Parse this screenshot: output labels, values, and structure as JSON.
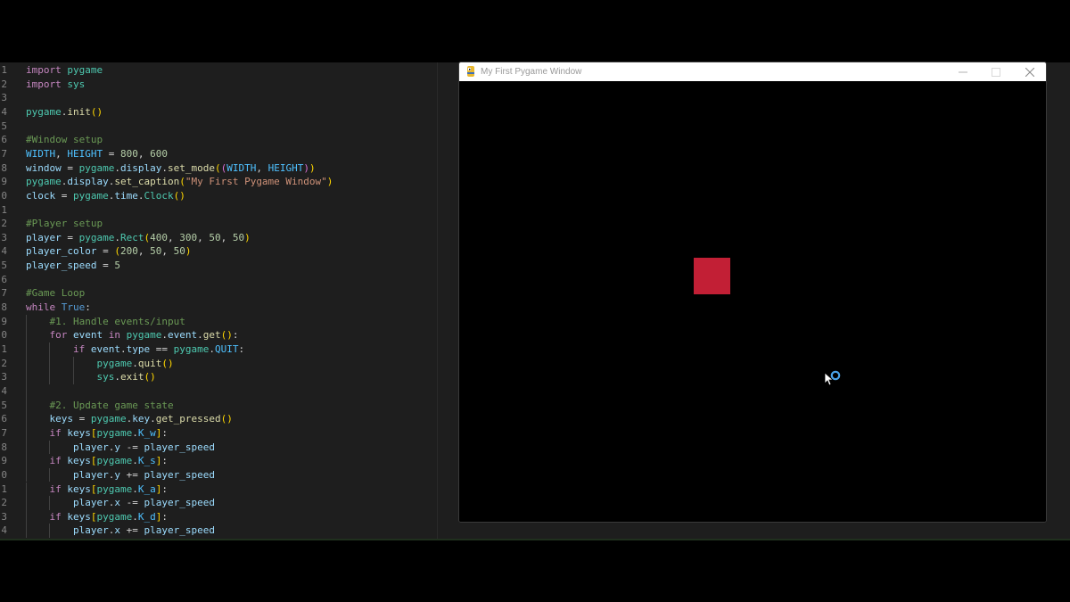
{
  "editor": {
    "line_numbers": [
      "1",
      "2",
      "3",
      "4",
      "5",
      "6",
      "7",
      "8",
      "9",
      "0",
      "1",
      "2",
      "3",
      "4",
      "5",
      "6",
      "7",
      "8",
      "9",
      "0",
      "1",
      "2",
      "3",
      "4",
      "5",
      "6",
      "7",
      "8",
      "9",
      "0",
      "1",
      "2",
      "3",
      "4"
    ],
    "lines": [
      [
        [
          "kw",
          "import"
        ],
        [
          "op",
          " "
        ],
        [
          "cls",
          "pygame"
        ]
      ],
      [
        [
          "kw",
          "import"
        ],
        [
          "op",
          " "
        ],
        [
          "cls",
          "sys"
        ]
      ],
      [],
      [
        [
          "cls",
          "pygame"
        ],
        [
          "op",
          "."
        ],
        [
          "fn",
          "init"
        ],
        [
          "br1",
          "()"
        ]
      ],
      [],
      [
        [
          "com",
          "#Window setup"
        ]
      ],
      [
        [
          "const",
          "WIDTH"
        ],
        [
          "op",
          ", "
        ],
        [
          "const",
          "HEIGHT"
        ],
        [
          "op",
          " = "
        ],
        [
          "num",
          "800"
        ],
        [
          "op",
          ", "
        ],
        [
          "num",
          "600"
        ]
      ],
      [
        [
          "var",
          "window"
        ],
        [
          "op",
          " = "
        ],
        [
          "cls",
          "pygame"
        ],
        [
          "op",
          "."
        ],
        [
          "var",
          "display"
        ],
        [
          "op",
          "."
        ],
        [
          "fn",
          "set_mode"
        ],
        [
          "br1",
          "("
        ],
        [
          "br2",
          "("
        ],
        [
          "const",
          "WIDTH"
        ],
        [
          "op",
          ", "
        ],
        [
          "const",
          "HEIGHT"
        ],
        [
          "br2",
          ")"
        ],
        [
          "br1",
          ")"
        ]
      ],
      [
        [
          "cls",
          "pygame"
        ],
        [
          "op",
          "."
        ],
        [
          "var",
          "display"
        ],
        [
          "op",
          "."
        ],
        [
          "fn",
          "set_caption"
        ],
        [
          "br1",
          "("
        ],
        [
          "str",
          "\"My First Pygame Window\""
        ],
        [
          "br1",
          ")"
        ]
      ],
      [
        [
          "var",
          "clock"
        ],
        [
          "op",
          " = "
        ],
        [
          "cls",
          "pygame"
        ],
        [
          "op",
          "."
        ],
        [
          "var",
          "time"
        ],
        [
          "op",
          "."
        ],
        [
          "cls",
          "Clock"
        ],
        [
          "br1",
          "()"
        ]
      ],
      [],
      [
        [
          "com",
          "#Player setup"
        ]
      ],
      [
        [
          "var",
          "player"
        ],
        [
          "op",
          " = "
        ],
        [
          "cls",
          "pygame"
        ],
        [
          "op",
          "."
        ],
        [
          "cls",
          "Rect"
        ],
        [
          "br1",
          "("
        ],
        [
          "num",
          "400"
        ],
        [
          "op",
          ", "
        ],
        [
          "num",
          "300"
        ],
        [
          "op",
          ", "
        ],
        [
          "num",
          "50"
        ],
        [
          "op",
          ", "
        ],
        [
          "num",
          "50"
        ],
        [
          "br1",
          ")"
        ]
      ],
      [
        [
          "var",
          "player_color"
        ],
        [
          "op",
          " = "
        ],
        [
          "br1",
          "("
        ],
        [
          "num",
          "200"
        ],
        [
          "op",
          ", "
        ],
        [
          "num",
          "50"
        ],
        [
          "op",
          ", "
        ],
        [
          "num",
          "50"
        ],
        [
          "br1",
          ")"
        ]
      ],
      [
        [
          "var",
          "player_speed"
        ],
        [
          "op",
          " = "
        ],
        [
          "num",
          "5"
        ]
      ],
      [],
      [
        [
          "com",
          "#Game Loop"
        ]
      ],
      [
        [
          "kw",
          "while"
        ],
        [
          "op",
          " "
        ],
        [
          "kw2",
          "True"
        ],
        [
          "op",
          ":"
        ]
      ],
      [
        [
          "op",
          "    "
        ],
        [
          "com",
          "#1. Handle events/input"
        ]
      ],
      [
        [
          "op",
          "    "
        ],
        [
          "kw",
          "for"
        ],
        [
          "op",
          " "
        ],
        [
          "var",
          "event"
        ],
        [
          "op",
          " "
        ],
        [
          "kw",
          "in"
        ],
        [
          "op",
          " "
        ],
        [
          "cls",
          "pygame"
        ],
        [
          "op",
          "."
        ],
        [
          "var",
          "event"
        ],
        [
          "op",
          "."
        ],
        [
          "fn",
          "get"
        ],
        [
          "br1",
          "()"
        ],
        [
          "op",
          ":"
        ]
      ],
      [
        [
          "op",
          "        "
        ],
        [
          "kw",
          "if"
        ],
        [
          "op",
          " "
        ],
        [
          "var",
          "event"
        ],
        [
          "op",
          "."
        ],
        [
          "var",
          "type"
        ],
        [
          "op",
          " == "
        ],
        [
          "cls",
          "pygame"
        ],
        [
          "op",
          "."
        ],
        [
          "const",
          "QUIT"
        ],
        [
          "op",
          ":"
        ]
      ],
      [
        [
          "op",
          "            "
        ],
        [
          "cls",
          "pygame"
        ],
        [
          "op",
          "."
        ],
        [
          "fn",
          "quit"
        ],
        [
          "br1",
          "()"
        ]
      ],
      [
        [
          "op",
          "            "
        ],
        [
          "cls",
          "sys"
        ],
        [
          "op",
          "."
        ],
        [
          "fn",
          "exit"
        ],
        [
          "br1",
          "()"
        ]
      ],
      [],
      [
        [
          "op",
          "    "
        ],
        [
          "com",
          "#2. Update game state"
        ]
      ],
      [
        [
          "op",
          "    "
        ],
        [
          "var",
          "keys"
        ],
        [
          "op",
          " = "
        ],
        [
          "cls",
          "pygame"
        ],
        [
          "op",
          "."
        ],
        [
          "var",
          "key"
        ],
        [
          "op",
          "."
        ],
        [
          "fn",
          "get_pressed"
        ],
        [
          "br1",
          "()"
        ]
      ],
      [
        [
          "op",
          "    "
        ],
        [
          "kw",
          "if"
        ],
        [
          "op",
          " "
        ],
        [
          "var",
          "keys"
        ],
        [
          "br1",
          "["
        ],
        [
          "cls",
          "pygame"
        ],
        [
          "op",
          "."
        ],
        [
          "const",
          "K_w"
        ],
        [
          "br1",
          "]"
        ],
        [
          "op",
          ":"
        ]
      ],
      [
        [
          "op",
          "        "
        ],
        [
          "var",
          "player"
        ],
        [
          "op",
          "."
        ],
        [
          "var",
          "y"
        ],
        [
          "op",
          " -= "
        ],
        [
          "var",
          "player_speed"
        ]
      ],
      [
        [
          "op",
          "    "
        ],
        [
          "kw",
          "if"
        ],
        [
          "op",
          " "
        ],
        [
          "var",
          "keys"
        ],
        [
          "br1",
          "["
        ],
        [
          "cls",
          "pygame"
        ],
        [
          "op",
          "."
        ],
        [
          "const",
          "K_s"
        ],
        [
          "br1",
          "]"
        ],
        [
          "op",
          ":"
        ]
      ],
      [
        [
          "op",
          "        "
        ],
        [
          "var",
          "player"
        ],
        [
          "op",
          "."
        ],
        [
          "var",
          "y"
        ],
        [
          "op",
          " += "
        ],
        [
          "var",
          "player_speed"
        ]
      ],
      [
        [
          "op",
          "    "
        ],
        [
          "kw",
          "if"
        ],
        [
          "op",
          " "
        ],
        [
          "var",
          "keys"
        ],
        [
          "br1",
          "["
        ],
        [
          "cls",
          "pygame"
        ],
        [
          "op",
          "."
        ],
        [
          "const",
          "K_a"
        ],
        [
          "br1",
          "]"
        ],
        [
          "op",
          ":"
        ]
      ],
      [
        [
          "op",
          "        "
        ],
        [
          "var",
          "player"
        ],
        [
          "op",
          "."
        ],
        [
          "var",
          "x"
        ],
        [
          "op",
          " -= "
        ],
        [
          "var",
          "player_speed"
        ]
      ],
      [
        [
          "op",
          "    "
        ],
        [
          "kw",
          "if"
        ],
        [
          "op",
          " "
        ],
        [
          "var",
          "keys"
        ],
        [
          "br1",
          "["
        ],
        [
          "cls",
          "pygame"
        ],
        [
          "op",
          "."
        ],
        [
          "const",
          "K_d"
        ],
        [
          "br1",
          "]"
        ],
        [
          "op",
          ":"
        ]
      ],
      [
        [
          "op",
          "        "
        ],
        [
          "var",
          "player"
        ],
        [
          "op",
          "."
        ],
        [
          "var",
          "x"
        ],
        [
          "op",
          " += "
        ],
        [
          "var",
          "player_speed"
        ]
      ]
    ]
  },
  "pygame_window": {
    "title": "My First Pygame Window",
    "controls": [
      "minimize-icon",
      "maximize-icon",
      "close-icon"
    ],
    "player_color": "#c21f35"
  },
  "colors": {
    "editor_bg": "#1e1e1e",
    "keyword": "#c586c0",
    "function": "#dcdcaa",
    "string": "#ce9178",
    "comment": "#6a9955",
    "number": "#b5cea8"
  }
}
